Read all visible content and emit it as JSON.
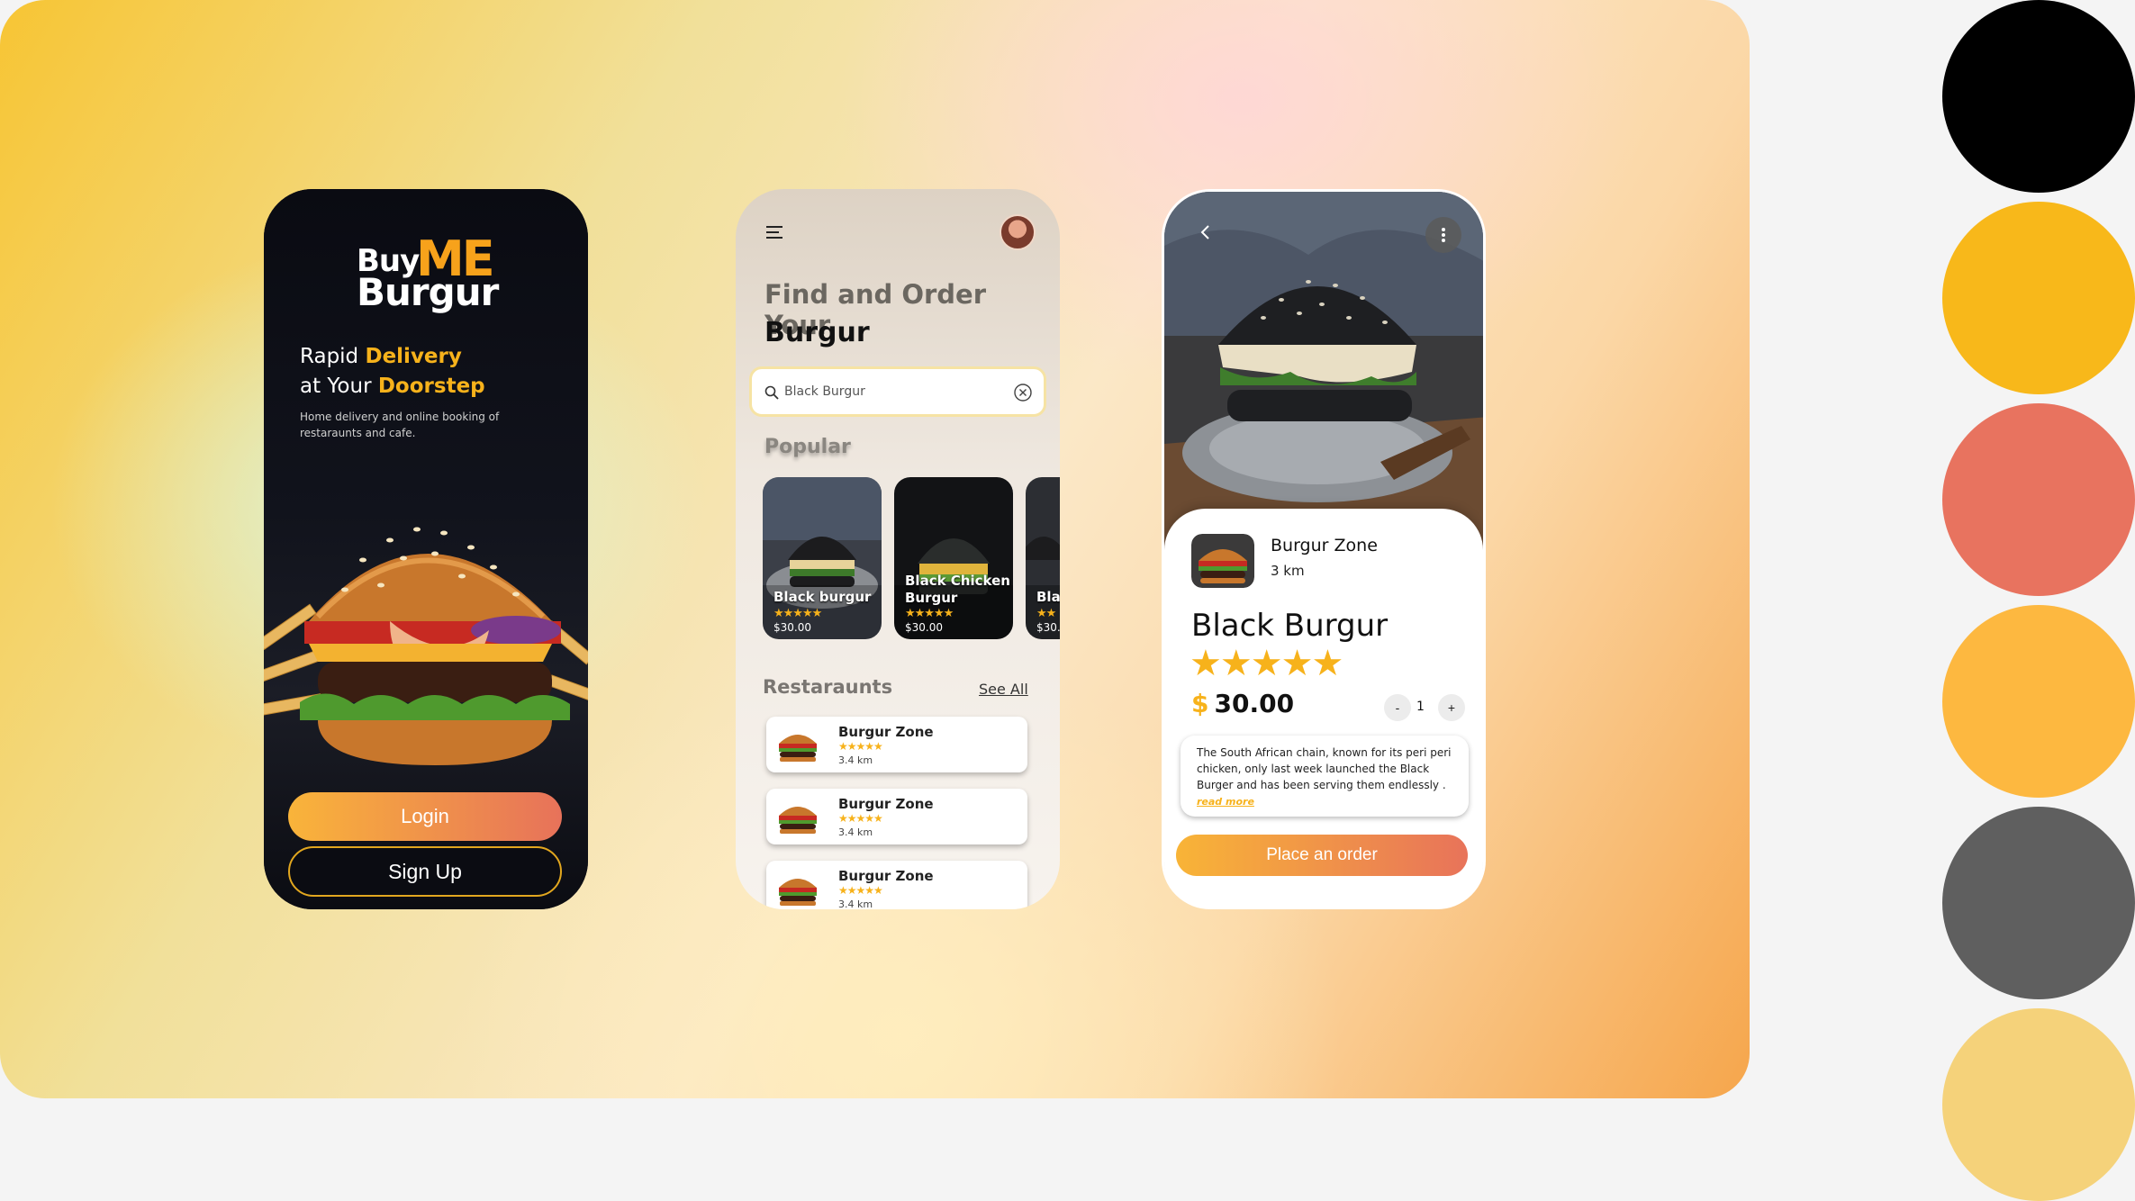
{
  "welcome": {
    "logo": {
      "buy": "Buy",
      "me": "ME",
      "burgur": "Burgur"
    },
    "tagline": {
      "line1_a": "Rapid ",
      "line1_b": "Delivery",
      "line2_a": "at Your ",
      "line2_b": "Doorstep"
    },
    "subtitle": "Home delivery and online booking of restaraunts and cafe.",
    "login_label": "Login",
    "signup_label": "Sign Up"
  },
  "home": {
    "heading_line1": "Find and Order Your",
    "heading_line2": "Burgur",
    "search": {
      "value": "Black Burgur"
    },
    "popular_title": "Popular",
    "popular": [
      {
        "name": "Black burgur",
        "stars": "★★★★★",
        "price": "$30.00"
      },
      {
        "name": "Black Chicken Burgur",
        "stars": "★★★★★",
        "price": "$30.00"
      },
      {
        "name": "Blac",
        "stars": "★★",
        "price": "$30."
      }
    ],
    "restaurants_title": "Restaraunts",
    "see_all": "See All",
    "restaurants": [
      {
        "name": "Burgur Zone",
        "stars": "★★★★★",
        "distance": "3.4 km"
      },
      {
        "name": "Burgur Zone",
        "stars": "★★★★★",
        "distance": "3.4 km"
      },
      {
        "name": "Burgur Zone",
        "stars": "★★★★★",
        "distance": "3.4 km"
      }
    ]
  },
  "detail": {
    "restaurant_name": "Burgur  Zone",
    "restaurant_distance": "3 km",
    "product_title": "Black Burgur",
    "rating": 5,
    "rating_stars": "★★★★★",
    "currency": "$",
    "price": "30.00",
    "qty_minus": "-",
    "quantity": "1",
    "qty_plus": "+",
    "description": "The South African chain, known for its peri peri chicken, only last week launched the Black Burger and has been serving them endlessly .",
    "read_more": "read more",
    "order_label": "Place an order"
  },
  "palette": [
    "#000000",
    "#f8b81a",
    "#e8735f",
    "#fdb840",
    "#5f5f5f",
    "#f5d27a"
  ]
}
